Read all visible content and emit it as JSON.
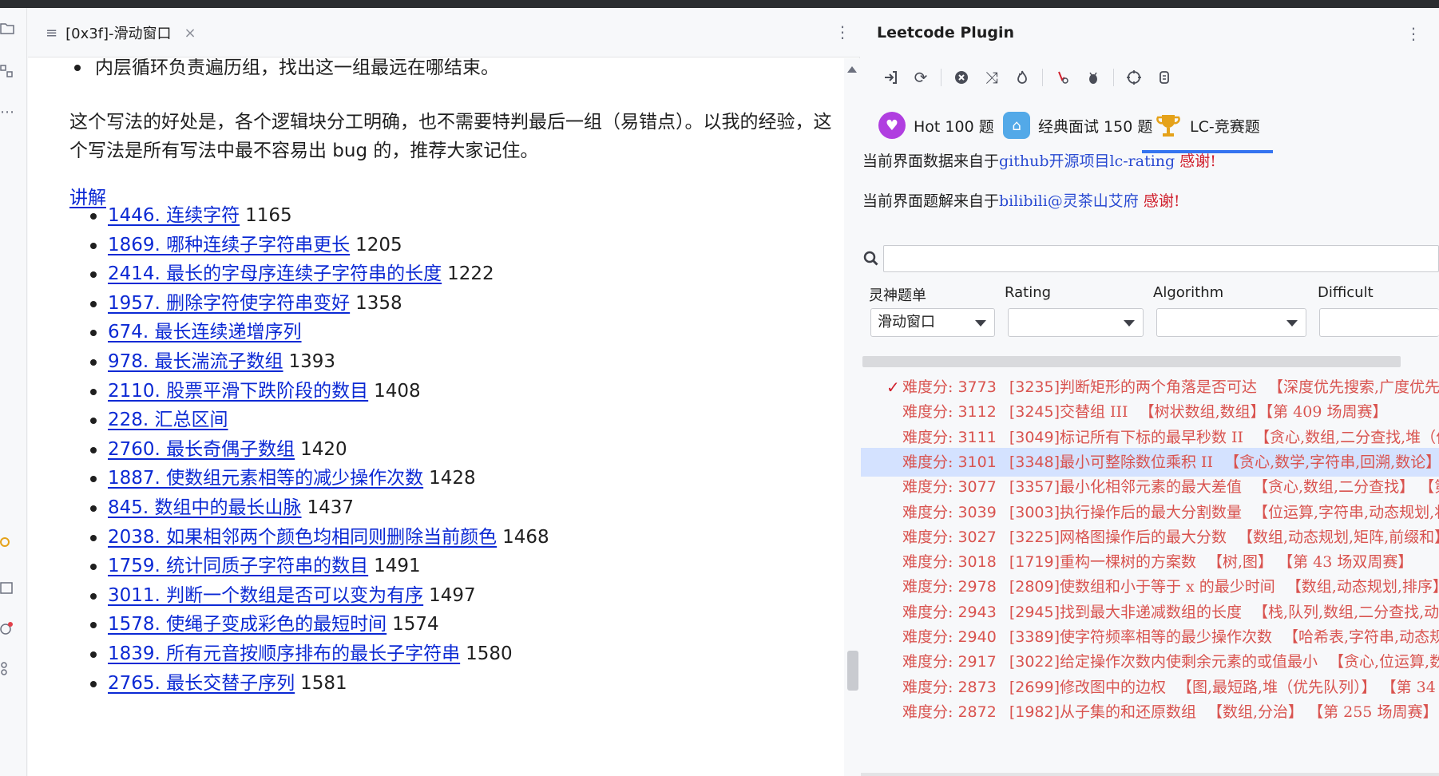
{
  "editor": {
    "tab_title": "[0x3f]-滑动窗口",
    "top_bullet": "内层循环负责遍历组，找出这一组最远在哪结束。",
    "paragraph": "这个写法的好处是，各个逻辑块分工明确，也不需要特判最后一组（易错点）。以我的经验，这个写法是所有写法中最不容易出 bug 的，推荐大家记住。",
    "explain_link": "讲解",
    "problems": [
      {
        "title": "1446. 连续字符",
        "score": "1165"
      },
      {
        "title": "1869. 哪种连续子字符串更长",
        "score": "1205"
      },
      {
        "title": "2414. 最长的字母序连续子字符串的长度",
        "score": "1222"
      },
      {
        "title": "1957. 删除字符使字符串变好",
        "score": "1358"
      },
      {
        "title": "674. 最长连续递增序列",
        "score": ""
      },
      {
        "title": "978. 最长湍流子数组",
        "score": "1393"
      },
      {
        "title": "2110. 股票平滑下跌阶段的数目",
        "score": "1408"
      },
      {
        "title": "228. 汇总区间",
        "score": ""
      },
      {
        "title": "2760. 最长奇偶子数组",
        "score": "1420"
      },
      {
        "title": "1887. 使数组元素相等的减少操作次数",
        "score": "1428"
      },
      {
        "title": "845. 数组中的最长山脉",
        "score": "1437"
      },
      {
        "title": "2038. 如果相邻两个颜色均相同则删除当前颜色",
        "score": "1468"
      },
      {
        "title": "1759. 统计同质子字符串的数目",
        "score": "1491"
      },
      {
        "title": "3011. 判断一个数组是否可以变为有序",
        "score": "1497"
      },
      {
        "title": "1578. 使绳子变成彩色的最短时间",
        "score": "1574"
      },
      {
        "title": "1839. 所有元音按顺序排布的最长子字符串",
        "score": "1580"
      },
      {
        "title": "2765. 最长交替子序列",
        "score": "1581"
      }
    ]
  },
  "panel": {
    "title": "Leetcode Plugin",
    "tabs": [
      {
        "label": "Hot 100 题",
        "icon": "heart-badge-icon",
        "color": "#b03ee0"
      },
      {
        "label": "经典面试 150 题",
        "icon": "top-badge-icon",
        "color": "#53a9e8"
      },
      {
        "label": "LC-竞赛题",
        "icon": "trophy-icon",
        "color": "#e5a21a"
      }
    ],
    "notice1": {
      "prefix": "当前界面数据来自于",
      "source": "github开源项目lc-rating",
      "thanks": " 感谢!"
    },
    "notice2": {
      "prefix": "当前界面题解来自于",
      "source": "bilibili@灵茶山艾府",
      "thanks": " 感谢!"
    },
    "filters": [
      {
        "label": "灵神题单",
        "value": "滑动窗口"
      },
      {
        "label": "Rating",
        "value": ""
      },
      {
        "label": "Algorithm",
        "value": ""
      },
      {
        "label": "Difficult",
        "value": ""
      }
    ],
    "rows": [
      {
        "score": "3773",
        "id": "[3235]",
        "name": "判断矩形的两个角落是否可达",
        "tags": "【深度优先搜索,广度优先搜",
        "checked": true
      },
      {
        "score": "3112",
        "id": "[3245]",
        "name": "交替组 III",
        "tags": "【树状数组,数组】【第 409 场周赛】",
        "checked": false
      },
      {
        "score": "3111",
        "id": "[3049]",
        "name": "标记所有下标的最早秒数 II",
        "tags": "【贪心,数组,二分查找,堆（优先",
        "checked": false
      },
      {
        "score": "3101",
        "id": "[3348]",
        "name": "最小可整除数位乘积 II",
        "tags": "【贪心,数学,字符串,回溯,数论】",
        "checked": false
      },
      {
        "score": "3077",
        "id": "[3357]",
        "name": "最小化相邻元素的最大差值",
        "tags": "【贪心,数组,二分查找】 【第",
        "checked": false
      },
      {
        "score": "3039",
        "id": "[3003]",
        "name": "执行操作后的最大分割数量",
        "tags": "【位运算,字符串,动态规划,状",
        "checked": false
      },
      {
        "score": "3027",
        "id": "[3225]",
        "name": "网格图操作后的最大分数",
        "tags": "【数组,动态规划,矩阵,前缀和】",
        "checked": false
      },
      {
        "score": "3018",
        "id": "[1719]",
        "name": "重构一棵树的方案数",
        "tags": "【树,图】 【第 43 场双周赛】",
        "checked": false
      },
      {
        "score": "2978",
        "id": "[2809]",
        "name": "使数组和小于等于 x 的最少时间",
        "tags": "【数组,动态规划,排序】",
        "checked": false
      },
      {
        "score": "2943",
        "id": "[2945]",
        "name": "找到最大非递减数组的长度",
        "tags": "【栈,队列,数组,二分查找,动态",
        "checked": false
      },
      {
        "score": "2940",
        "id": "[3389]",
        "name": "使字符频率相等的最少操作次数",
        "tags": "【哈希表,字符串,动态规",
        "checked": false
      },
      {
        "score": "2917",
        "id": "[3022]",
        "name": "给定操作次数内使剩余元素的或值最小",
        "tags": "【贪心,位运算,数",
        "checked": false
      },
      {
        "score": "2873",
        "id": "[2699]",
        "name": "修改图中的边权",
        "tags": "【图,最短路,堆（优先队列）】 【第 34",
        "checked": false
      },
      {
        "score": "2872",
        "id": "[1982]",
        "name": "从子集的和还原数组",
        "tags": "【数组,分治】 【第 255 场周赛】",
        "checked": false
      }
    ],
    "row_prefix": "难度分: "
  }
}
